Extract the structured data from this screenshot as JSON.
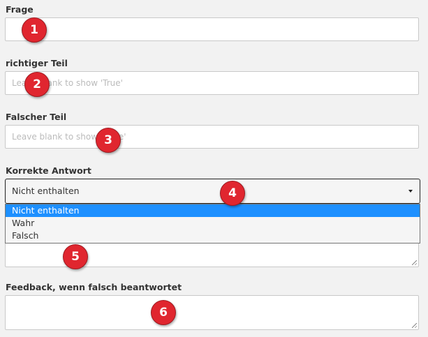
{
  "fields": {
    "frage": {
      "label": "Frage",
      "value": ""
    },
    "richtiger_teil": {
      "label": "richtiger Teil",
      "placeholder": "Leave blank to show 'True'"
    },
    "falscher_teil": {
      "label": "Falscher Teil",
      "placeholder": "Leave blank to show 'False'"
    },
    "korrekte_antwort": {
      "label": "Korrekte Antwort",
      "selected": "Nicht enthalten",
      "options": [
        "Nicht enthalten",
        "Wahr",
        "Falsch"
      ]
    },
    "feedback_falsch": {
      "label": "Feedback, wenn falsch beantwortet"
    }
  },
  "badges": [
    "1",
    "2",
    "3",
    "4",
    "5",
    "6"
  ],
  "colors": {
    "badge": "#e0262f",
    "option_highlight": "#1e90ff",
    "background": "#f2f2f2"
  }
}
